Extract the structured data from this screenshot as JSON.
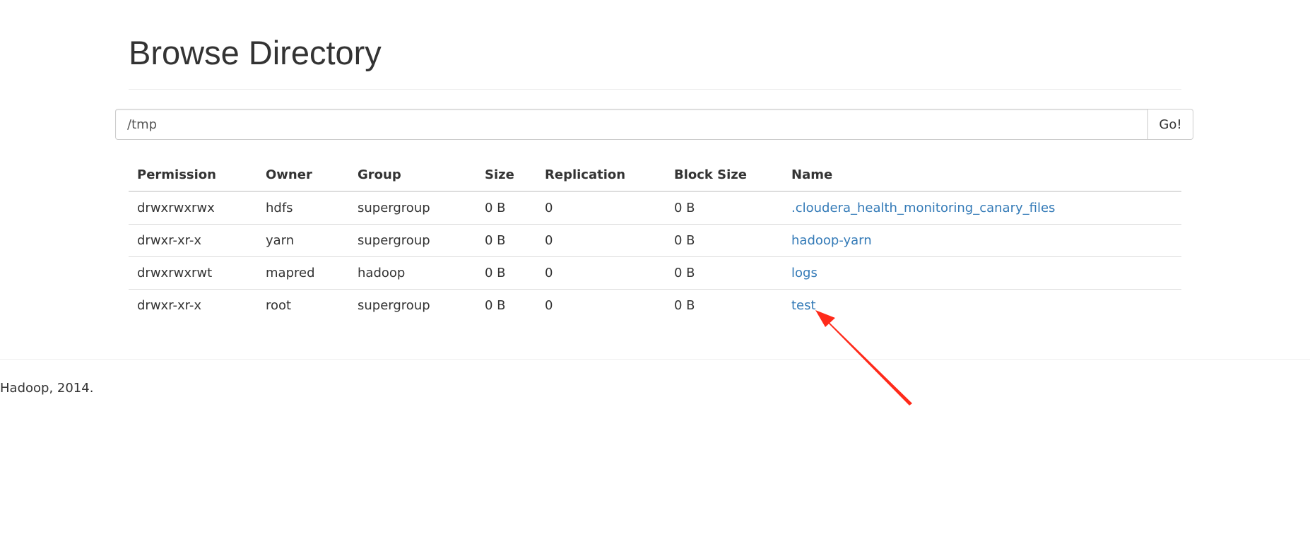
{
  "page": {
    "title": "Browse Directory"
  },
  "path_bar": {
    "value": "/tmp",
    "go_label": "Go!"
  },
  "table": {
    "headers": {
      "permission": "Permission",
      "owner": "Owner",
      "group": "Group",
      "size": "Size",
      "replication": "Replication",
      "block_size": "Block Size",
      "name": "Name"
    },
    "rows": [
      {
        "permission": "drwxrwxrwx",
        "owner": "hdfs",
        "group": "supergroup",
        "size": "0 B",
        "replication": "0",
        "block_size": "0 B",
        "name": ".cloudera_health_monitoring_canary_files"
      },
      {
        "permission": "drwxr-xr-x",
        "owner": "yarn",
        "group": "supergroup",
        "size": "0 B",
        "replication": "0",
        "block_size": "0 B",
        "name": "hadoop-yarn"
      },
      {
        "permission": "drwxrwxrwt",
        "owner": "mapred",
        "group": "hadoop",
        "size": "0 B",
        "replication": "0",
        "block_size": "0 B",
        "name": "logs"
      },
      {
        "permission": "drwxr-xr-x",
        "owner": "root",
        "group": "supergroup",
        "size": "0 B",
        "replication": "0",
        "block_size": "0 B",
        "name": "test"
      }
    ]
  },
  "footer": {
    "text": "Hadoop, 2014."
  },
  "colors": {
    "link": "#337ab7",
    "annotation_arrow": "#ff2a1a"
  },
  "annotation": {
    "icon": "red-arrow-icon"
  }
}
